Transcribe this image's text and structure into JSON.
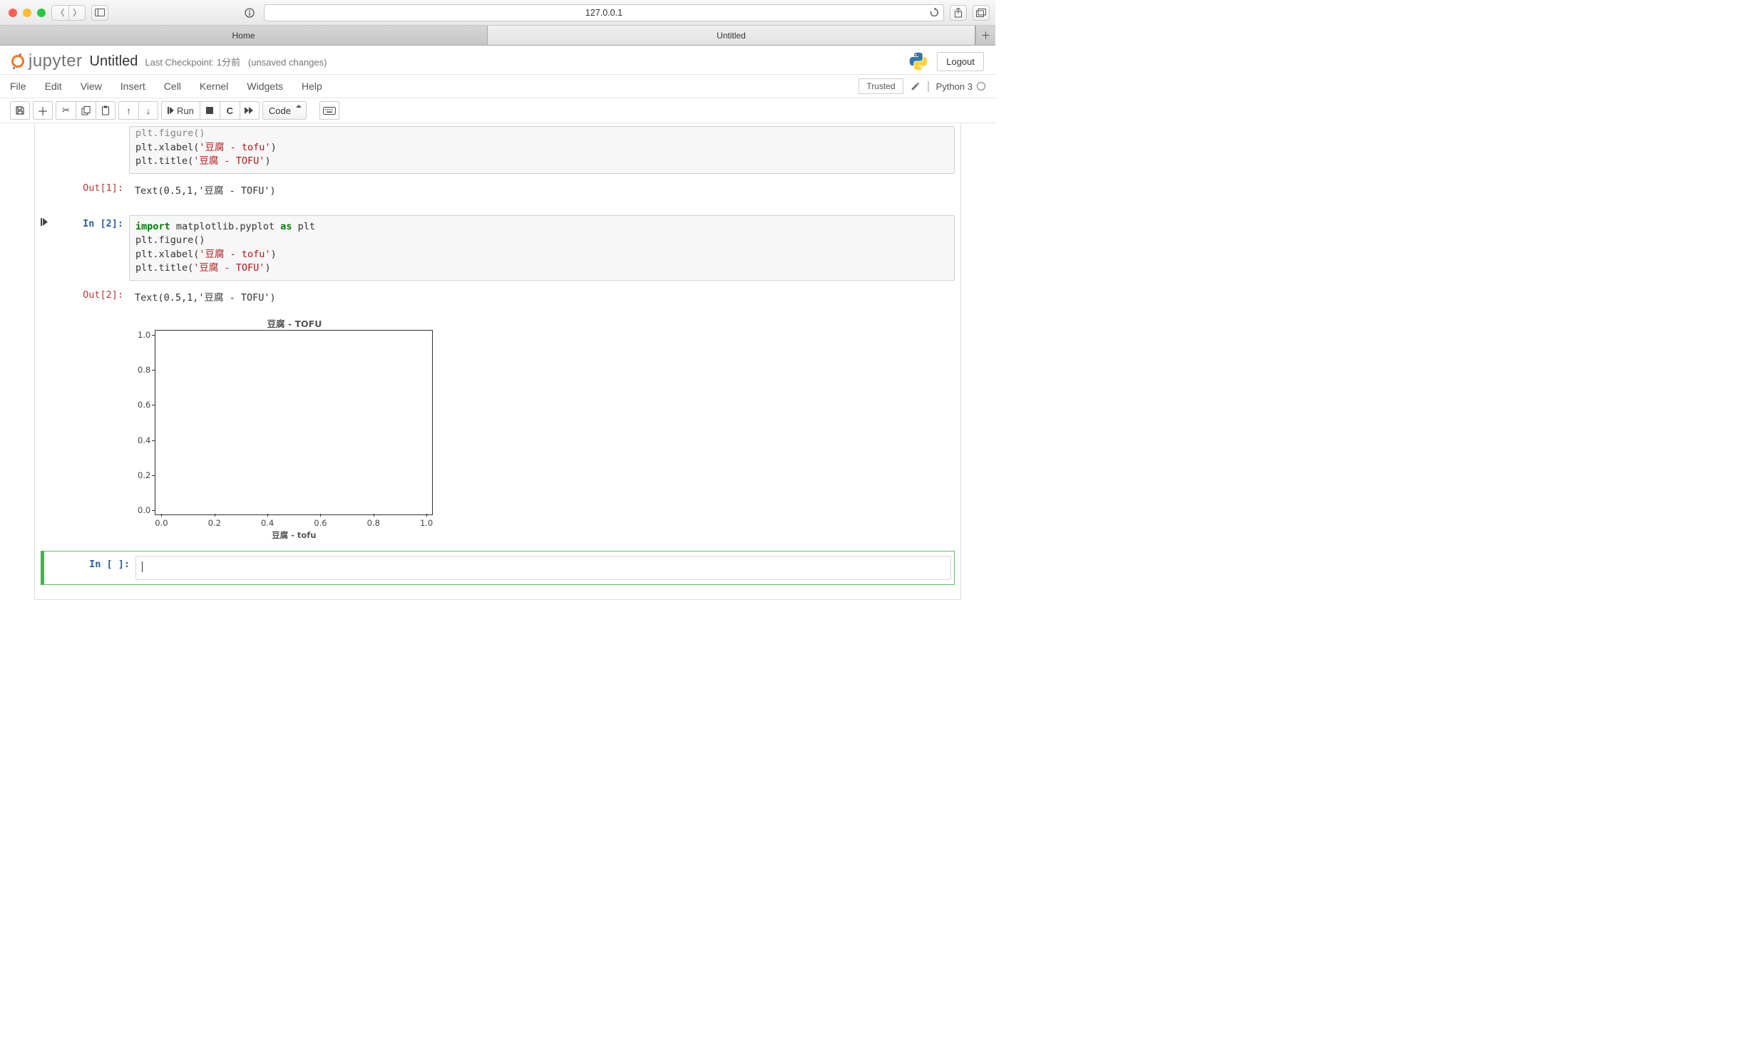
{
  "browser": {
    "address": "127.0.0.1",
    "tabs": [
      "Home",
      "Untitled"
    ]
  },
  "header": {
    "logo_text": "jupyter",
    "title": "Untitled",
    "checkpoint": "Last Checkpoint: 1分前",
    "unsaved": "(unsaved changes)",
    "logout": "Logout"
  },
  "menus": [
    "File",
    "Edit",
    "View",
    "Insert",
    "Cell",
    "Kernel",
    "Widgets",
    "Help"
  ],
  "menubar_right": {
    "trusted": "Trusted",
    "kernel": "Python 3"
  },
  "toolbar": {
    "run_label": "Run",
    "celltype": "Code"
  },
  "cells": {
    "cell1": {
      "code_visible_lines": [
        {
          "plain": "plt.figure()"
        },
        {
          "fn": "plt.xlabel(",
          "str": "'豆腐 - tofu'",
          "close": ")"
        },
        {
          "fn": "plt.title(",
          "str": "'豆腐 - TOFU'",
          "close": ")"
        }
      ],
      "out_label": "Out[1]:",
      "out_text": "Text(0.5,1,'豆腐 - TOFU')"
    },
    "cell2": {
      "in_label": "In [2]:",
      "code": {
        "l1a": "import",
        "l1b": " matplotlib.pyplot ",
        "l1c": "as",
        "l1d": " plt",
        "l2": "plt.figure()",
        "l3a": "plt.xlabel(",
        "l3b": "'豆腐 - tofu'",
        "l3c": ")",
        "l4a": "plt.title(",
        "l4b": "'豆腐 - TOFU'",
        "l4c": ")"
      },
      "out_label": "Out[2]:",
      "out_text": "Text(0.5,1,'豆腐 - TOFU')"
    },
    "cell3": {
      "in_label": "In [ ]:"
    }
  },
  "chart_data": {
    "type": "line",
    "title": "豆腐 - TOFU",
    "xlabel": "豆腐 - tofu",
    "ylabel": "",
    "xlim": [
      0.0,
      1.0
    ],
    "ylim": [
      0.0,
      1.0
    ],
    "xticks": [
      "0.0",
      "0.2",
      "0.4",
      "0.6",
      "0.8",
      "1.0"
    ],
    "yticks": [
      "1.0",
      "0.8",
      "0.6",
      "0.4",
      "0.2",
      "0.0"
    ],
    "series": []
  }
}
